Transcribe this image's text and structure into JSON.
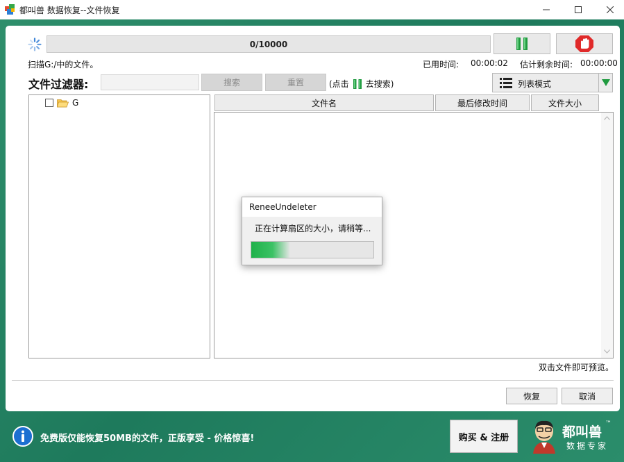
{
  "window": {
    "title": "都叫兽 数据恢复--文件恢复",
    "minimize_icon": "minimize-icon",
    "maximize_icon": "maximize-icon",
    "close_icon": "close-icon"
  },
  "scan": {
    "progress_text": "0/10000",
    "progress_fraction": 0,
    "status": "扫描G:/中的文件。",
    "elapsed_label": "已用时间:",
    "elapsed_value": "00:00:02",
    "remaining_label": "估计剩余时间:",
    "remaining_value": "00:00:00"
  },
  "filter": {
    "label": "文件过滤器:",
    "input_value": "",
    "search_button": "搜索",
    "reset_button": "重置",
    "hint_prefix": "(点击",
    "hint_suffix": "去搜索)"
  },
  "view_mode": {
    "label": "列表模式"
  },
  "tree": {
    "items": [
      {
        "label": "G",
        "checked": false
      }
    ]
  },
  "table": {
    "columns": [
      "文件名",
      "最后修改时间",
      "文件大小"
    ],
    "rows": []
  },
  "preview_hint": "双击文件即可预览。",
  "actions": {
    "recover": "恢复",
    "cancel": "取消"
  },
  "dialog": {
    "title": "ReneeUndeleter",
    "message": "正在计算扇区的大小，请稍等...",
    "progress_fraction": 0.32
  },
  "banner": {
    "text": "免费版仅能恢复50MB的文件，正版享受 - 价格惊喜!",
    "buy_button": "购买 & 注册",
    "logo_text": "都叫兽",
    "logo_subtext": "数据专家",
    "logo_tm": "™"
  },
  "colors": {
    "accent_green": "#1fa64a",
    "stop_red": "#e02a2a",
    "background_teal": "#2b8d6b"
  }
}
